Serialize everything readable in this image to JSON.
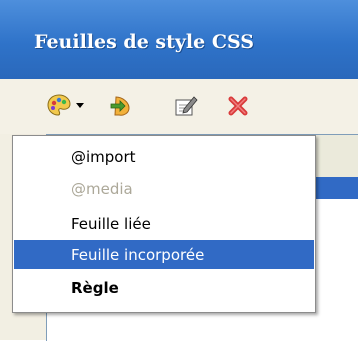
{
  "window": {
    "title": "Feuilles de style CSS"
  },
  "toolbar": {
    "buttons": [
      {
        "name": "new-style-button",
        "icon": "palette-icon"
      },
      {
        "name": "attach-style-button",
        "icon": "attach-icon"
      },
      {
        "name": "edit-style-button",
        "icon": "edit-icon"
      },
      {
        "name": "delete-style-button",
        "icon": "delete-icon"
      }
    ]
  },
  "menu": {
    "items": [
      {
        "label": "@import",
        "state": "normal"
      },
      {
        "label": "@media",
        "state": "disabled"
      },
      {
        "label": "Feuille liée",
        "state": "normal"
      },
      {
        "label": "Feuille incorporée",
        "state": "highlighted"
      },
      {
        "label": "Règle",
        "state": "bold"
      }
    ]
  },
  "colors": {
    "titlebar": "#2f73c9",
    "selection": "#316ac5",
    "disabled_text": "#aca899",
    "delete_red": "#d93a3a"
  }
}
